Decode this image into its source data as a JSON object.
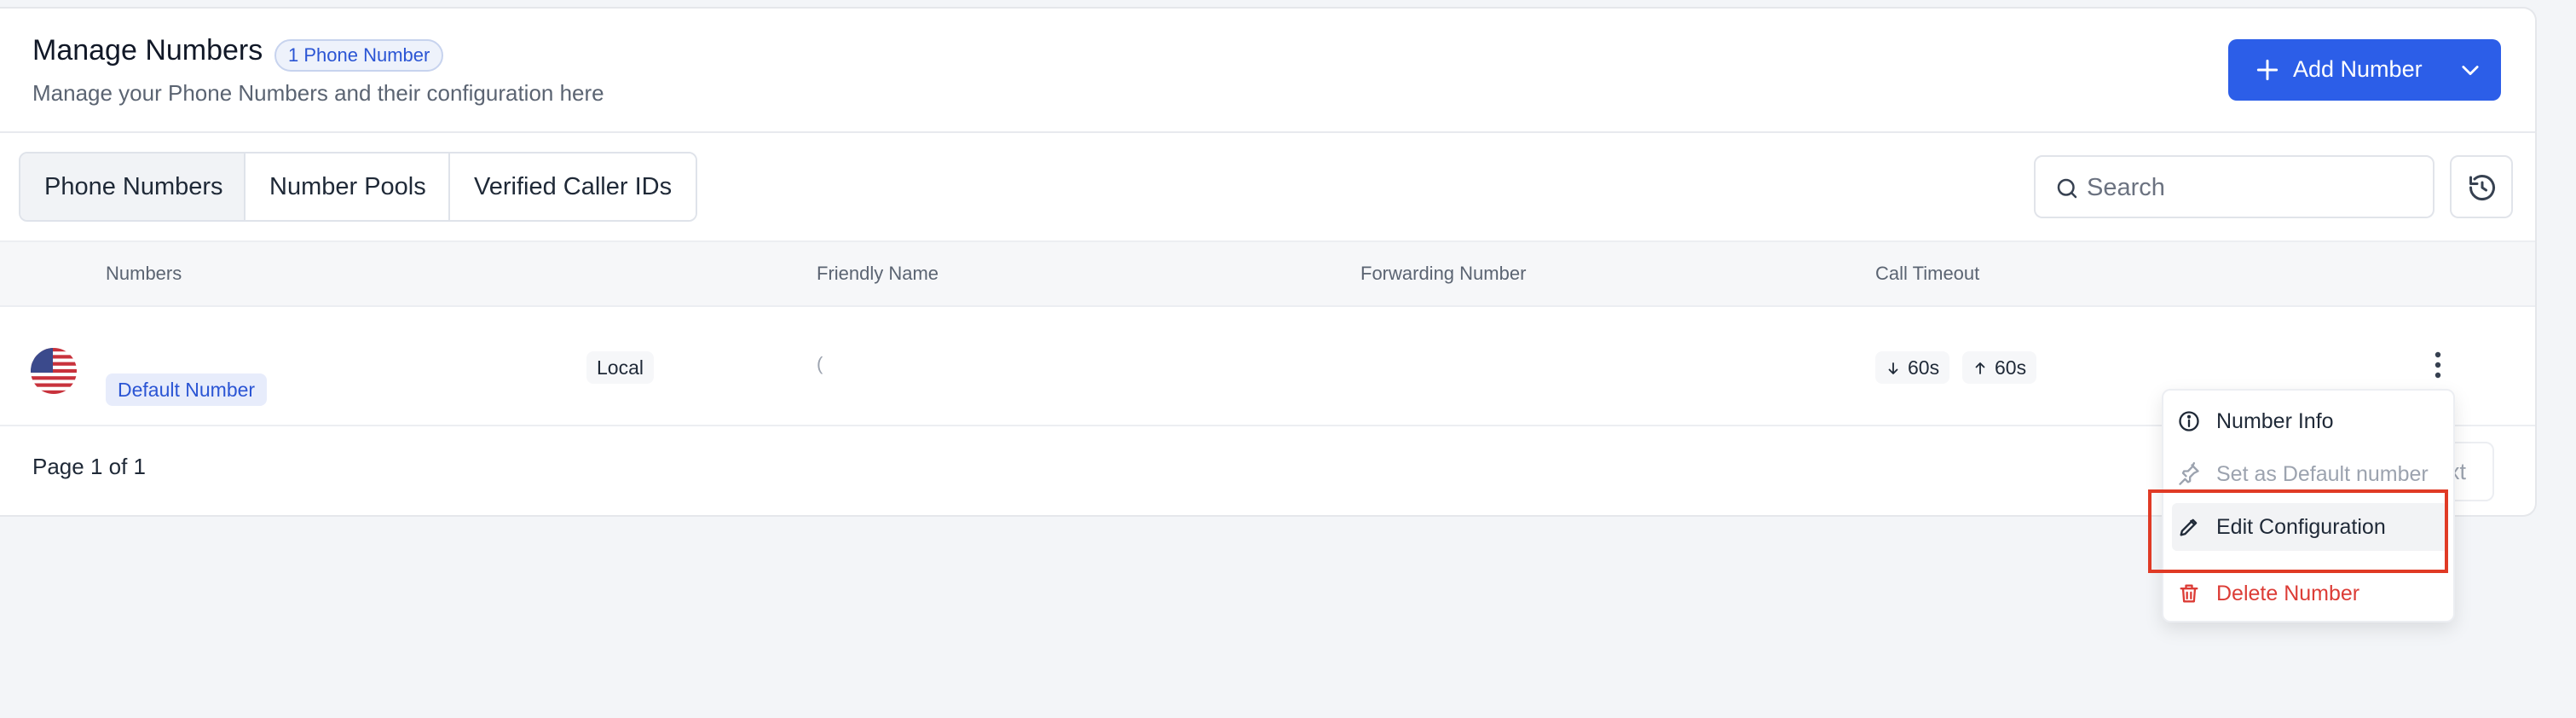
{
  "header": {
    "title": "Manage Numbers",
    "count_badge": "1 Phone Number",
    "subtitle": "Manage your Phone Numbers and their configuration here",
    "add_button_label": "Add Number"
  },
  "tabs": [
    {
      "label": "Phone Numbers",
      "active": true
    },
    {
      "label": "Number Pools",
      "active": false
    },
    {
      "label": "Verified Caller IDs",
      "active": false
    }
  ],
  "search": {
    "placeholder": "Search"
  },
  "table": {
    "columns": [
      "Numbers",
      "Friendly Name",
      "Forwarding Number",
      "Call Timeout"
    ],
    "rows": [
      {
        "flag_icon": "us-flag-icon",
        "default_badge": "Default Number",
        "type": "Local",
        "friendly_name": "(",
        "forwarding_number": "",
        "timeout_in": "60s",
        "timeout_out": "60s"
      }
    ]
  },
  "pagination": {
    "page_text": "Page 1 of 1",
    "next_label": "xt"
  },
  "row_menu": {
    "items": [
      {
        "label": "Number Info",
        "icon": "info-icon"
      },
      {
        "label": "Set as Default number",
        "icon": "pin-icon",
        "disabled": true
      },
      {
        "label": "Edit Configuration",
        "icon": "pencil-icon",
        "highlighted": true
      },
      {
        "label": "Delete Number",
        "icon": "trash-icon",
        "danger": true
      }
    ]
  },
  "colors": {
    "primary": "#2c5ee8",
    "badge_text": "#2b55d4",
    "danger": "#dc3c36",
    "highlight_outline": "#e03a25"
  }
}
